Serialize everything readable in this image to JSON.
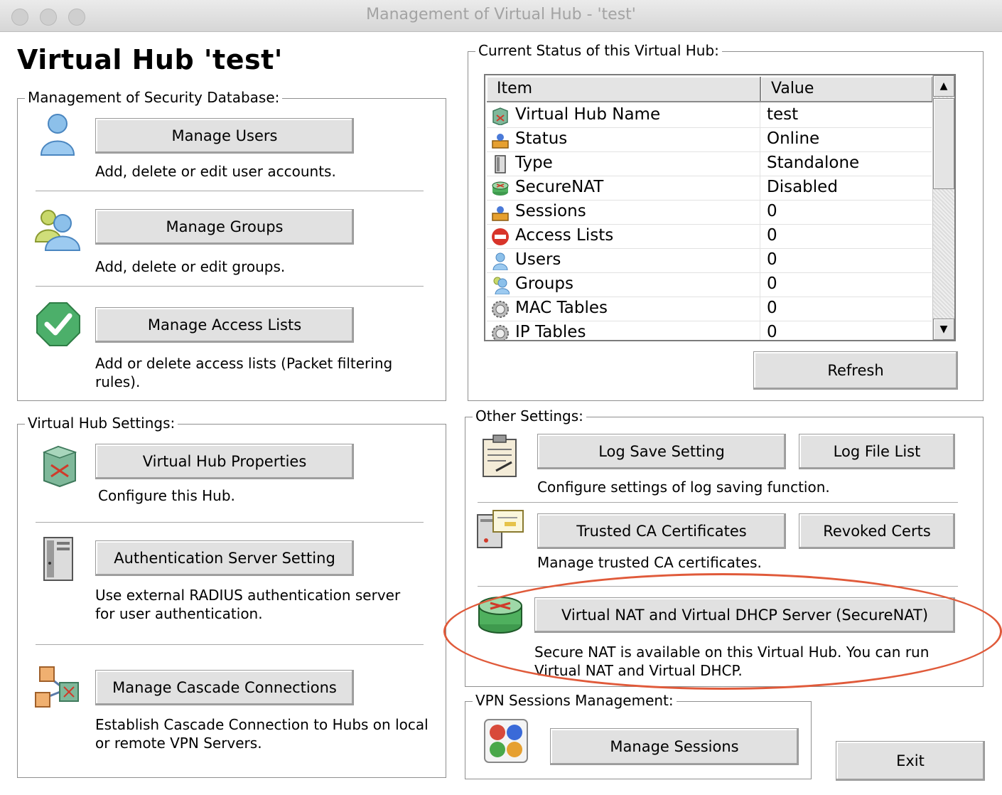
{
  "window": {
    "title": "Management of Virtual Hub - 'test'"
  },
  "hub_title": "Virtual Hub 'test'",
  "security_db": {
    "legend": "Management of Security Database:",
    "items": [
      {
        "icon": "user-icon",
        "button": "Manage Users",
        "desc": "Add, delete or edit user accounts."
      },
      {
        "icon": "group-icon",
        "button": "Manage Groups",
        "desc": "Add, delete or edit groups."
      },
      {
        "icon": "checkmark-icon",
        "button": "Manage Access Lists",
        "desc": "Add or delete access lists (Packet filtering rules)."
      }
    ]
  },
  "hub_settings": {
    "legend": "Virtual Hub Settings:",
    "items": [
      {
        "icon": "hub-icon",
        "button": "Virtual Hub Properties",
        "desc": "Configure this Hub."
      },
      {
        "icon": "server-icon",
        "button": "Authentication Server Setting",
        "desc": "Use external RADIUS authentication server for user authentication."
      },
      {
        "icon": "cascade-icon",
        "button": "Manage Cascade Connections",
        "desc": "Establish Cascade Connection to Hubs on local or remote VPN Servers."
      }
    ]
  },
  "status": {
    "legend": "Current Status of this Virtual Hub:",
    "columns": [
      "Item",
      "Value"
    ],
    "rows": [
      {
        "icon": "hub-icon",
        "item": "Virtual Hub Name",
        "value": "test"
      },
      {
        "icon": "status-icon",
        "item": "Status",
        "value": "Online"
      },
      {
        "icon": "server-icon",
        "item": "Type",
        "value": "Standalone"
      },
      {
        "icon": "router-icon",
        "item": "SecureNAT",
        "value": "Disabled"
      },
      {
        "icon": "sessions-icon",
        "item": "Sessions",
        "value": "0"
      },
      {
        "icon": "no-entry-icon",
        "item": "Access Lists",
        "value": "0"
      },
      {
        "icon": "user-icon",
        "item": "Users",
        "value": "0"
      },
      {
        "icon": "group-icon",
        "item": "Groups",
        "value": "0"
      },
      {
        "icon": "gear-icon",
        "item": "MAC Tables",
        "value": "0"
      },
      {
        "icon": "gear-icon",
        "item": "IP Tables",
        "value": "0"
      }
    ],
    "refresh": "Refresh"
  },
  "other": {
    "legend": "Other Settings:",
    "log_save": "Log Save Setting",
    "log_list": "Log File List",
    "log_desc": "Configure settings of log saving function.",
    "trusted_ca": "Trusted CA Certificates",
    "revoked": "Revoked Certs",
    "ca_desc": "Manage trusted CA certificates.",
    "securenat": "Virtual NAT and Virtual DHCP Server (SecureNAT)",
    "securenat_desc": "Secure NAT is available on this Virtual Hub. You can run Virtual NAT and Virtual DHCP."
  },
  "sessions": {
    "legend": "VPN Sessions Management:",
    "button": "Manage Sessions"
  },
  "exit": "Exit",
  "colors": {
    "highlight": "#e05a3a",
    "button_face": "#e1e1e1"
  }
}
